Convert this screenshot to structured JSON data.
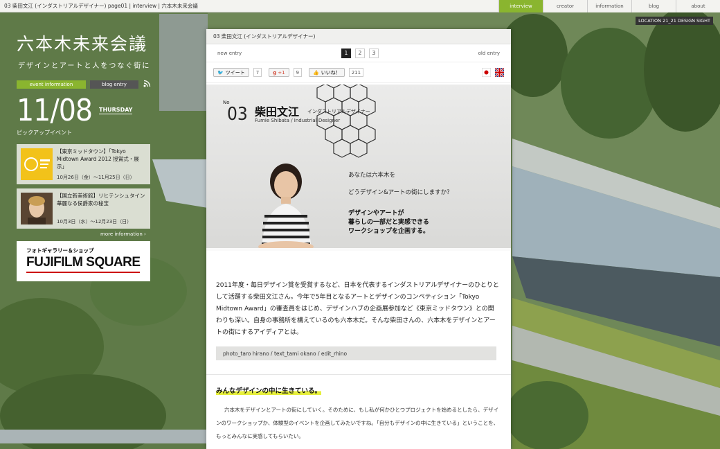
{
  "topbar": {
    "breadcrumb": "03 柴田文江 (インダストリアルデザイナー) page01 | interview | 六本木未来会議",
    "nav": [
      {
        "label": "interview",
        "active": true
      },
      {
        "label": "creator",
        "active": false
      },
      {
        "label": "information",
        "active": false
      },
      {
        "label": "blog",
        "active": false
      },
      {
        "label": "about",
        "active": false
      }
    ],
    "location": "LOCATION 21_21 DESIGN SIGHT"
  },
  "sidebar": {
    "logo": "六本木未来会議",
    "tagline": "デザインとアートと人をつなぐ街に",
    "tab_event": "event information",
    "tab_blog": "blog entry",
    "date": "11/08",
    "weekday": "THURSDAY",
    "pickup": "ピックアップイベント",
    "events": [
      {
        "title": "【東京ミッドタウン】「Tokyo Midtown Award 2012 授賞式・展示」",
        "date": "10月26日（金）〜11月25日（日）"
      },
      {
        "title": "【国立新美術館】リヒテンシュタイン 華麗なる侯爵家の秘宝",
        "date": "10月3日（水）〜12月23日（日）"
      }
    ],
    "more": "more information ›",
    "fuji_sub": "フォトギャラリー＆ショップ",
    "fuji_name": "FUJIFILM SQUARE"
  },
  "article": {
    "header": "03 柴田文江 (インダストリアルデザイナー)",
    "new_entry": "new entry",
    "old_entry": "old entry",
    "pages": [
      "1",
      "2",
      "3"
    ],
    "tweet": "ツイート",
    "tweet_count": "7",
    "gplus": "+1",
    "gplus_count": "9",
    "like": "いいね！",
    "like_count": "211",
    "no": "No",
    "num": "03",
    "name": "柴田文江",
    "role": "インダストリアルデザイナー",
    "name_en": "Fumie Shibata / Industrial Designer",
    "q1": "あなたは六本木を",
    "q2": "どうデザイン&アートの街にしますか？",
    "a1": "デザインやアートが",
    "a2": "暮らしの一部だと実感できる",
    "a3": "ワークショップを企画する。",
    "body": "2011年度・毎日デザイン賞を受賞するなど、日本を代表するインダストリアルデザイナーのひとりとして活躍する柴田文江さん。今年で5年目となるアートとデザインのコンペティション「Tokyo Midtown Award」の審査員をはじめ、デザインハブの企画展参加など《東京ミッドタウン》との関わりも深い。自身の事務所を構えているのも六本木だ。そんな柴田さんの、六本木をデザインとアートの街にするアイディアとは。",
    "credit": "photo_taro hirano / text_tami okano / edit_rhino",
    "section": "みんなデザインの中に生きている。",
    "p1": "六本木をデザインとアートの街にしていく。そのために、もし私が何かひとつプロジェクトを始めるとしたら、デザインのワークショップか、体験型のイベントを企画してみたいですね。「自分もデザインの中に生きている」ということを、もっとみんなに実感してもらいたい。"
  },
  "colors": {
    "accent": "#8ab52f",
    "highlight": "#e6ef3c"
  }
}
